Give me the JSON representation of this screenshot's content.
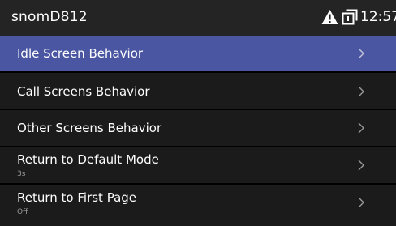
{
  "status_bar": {
    "device_name": "snomD812",
    "time": "12:57",
    "icons": [
      "warning-icon",
      "window-icon"
    ]
  },
  "menu": {
    "items": [
      {
        "label": "Idle Screen Behavior",
        "value": "",
        "selected": true,
        "icon": "chevron-right-icon"
      },
      {
        "label": "Call Screens Behavior",
        "value": "",
        "selected": false,
        "icon": "chevron-right-icon"
      },
      {
        "label": "Other Screens Behavior",
        "value": "",
        "selected": false,
        "icon": "chevron-right-icon"
      },
      {
        "label": "Return to Default Mode",
        "value": "3s",
        "selected": false,
        "icon": "chevron-right-icon"
      },
      {
        "label": "Return to First Page",
        "value": "Off",
        "selected": false,
        "icon": "chevron-right-icon"
      }
    ]
  },
  "colors": {
    "status_bar_bg": "#242424",
    "background": "#1b1b1b",
    "selected_bg": "#4a56a1",
    "divider": "#000000",
    "text": "#ffffff",
    "subtext": "#9a9a9a"
  }
}
